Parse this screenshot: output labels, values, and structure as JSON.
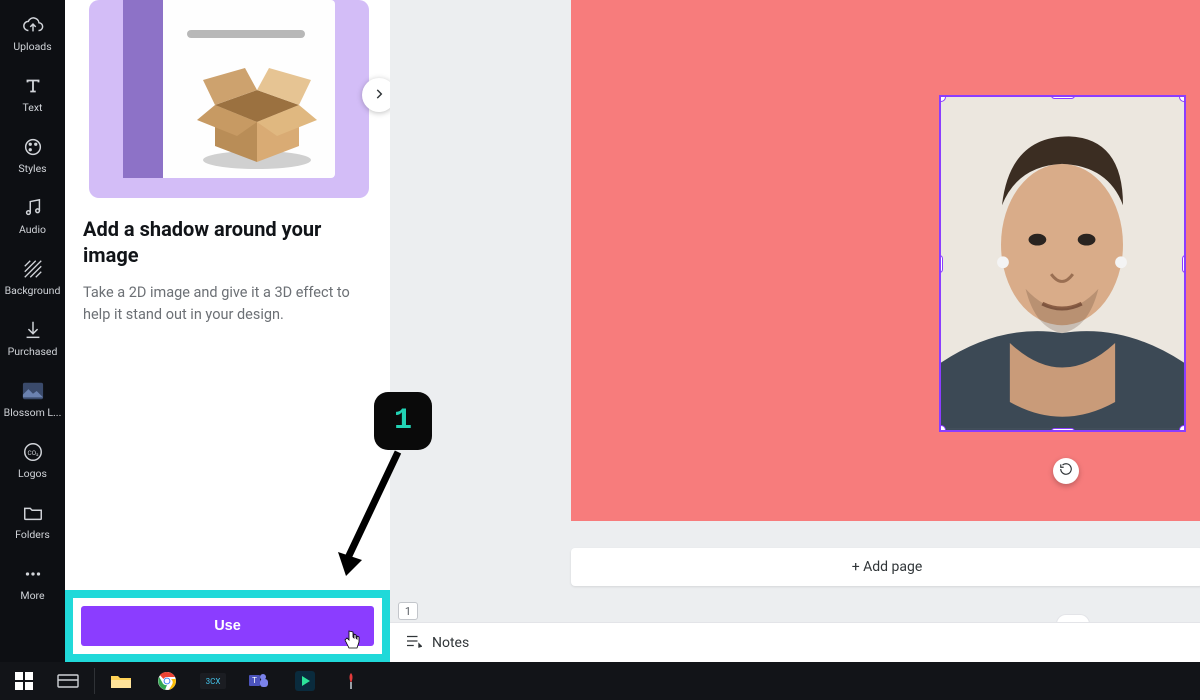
{
  "nav": {
    "items": [
      {
        "key": "uploads",
        "label": "Uploads"
      },
      {
        "key": "text",
        "label": "Text"
      },
      {
        "key": "styles",
        "label": "Styles"
      },
      {
        "key": "audio",
        "label": "Audio"
      },
      {
        "key": "background",
        "label": "Background"
      },
      {
        "key": "purchased",
        "label": "Purchased"
      },
      {
        "key": "blossom",
        "label": "Blossom L..."
      },
      {
        "key": "logos",
        "label": "Logos"
      },
      {
        "key": "folders",
        "label": "Folders"
      },
      {
        "key": "more",
        "label": "More"
      }
    ]
  },
  "panel": {
    "title": "Add a shadow around your image",
    "description": "Take a 2D image and give it a 3D effect to help it stand out in your design.",
    "use_label": "Use"
  },
  "annotation": {
    "badge": "1"
  },
  "canvas": {
    "add_page_label": "+ Add page",
    "page_indicator": "1"
  },
  "bottom_bar": {
    "notes_label": "Notes"
  },
  "colors": {
    "accent": "#8b3dff",
    "highlight": "#20d9d9",
    "canvas_bg": "#f77c7c"
  }
}
